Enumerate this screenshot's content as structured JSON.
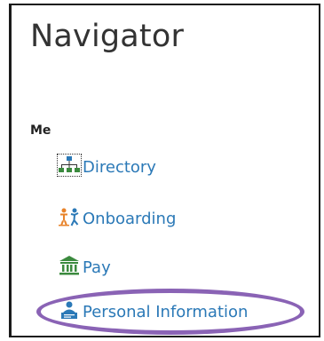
{
  "navigator": {
    "title": "Navigator",
    "section_label": "Me",
    "items": [
      {
        "label": "Directory",
        "icon": "org-chart-icon"
      },
      {
        "label": "Onboarding",
        "icon": "onboarding-people-icon"
      },
      {
        "label": "Pay",
        "icon": "bank-building-icon"
      },
      {
        "label": "Personal Information",
        "icon": "person-card-icon"
      }
    ]
  },
  "colors": {
    "link": "#2b79b7",
    "icon_green": "#3b8a3e",
    "icon_orange": "#e8832a",
    "icon_blue": "#2b79b7",
    "highlight": "#8a63b5"
  }
}
